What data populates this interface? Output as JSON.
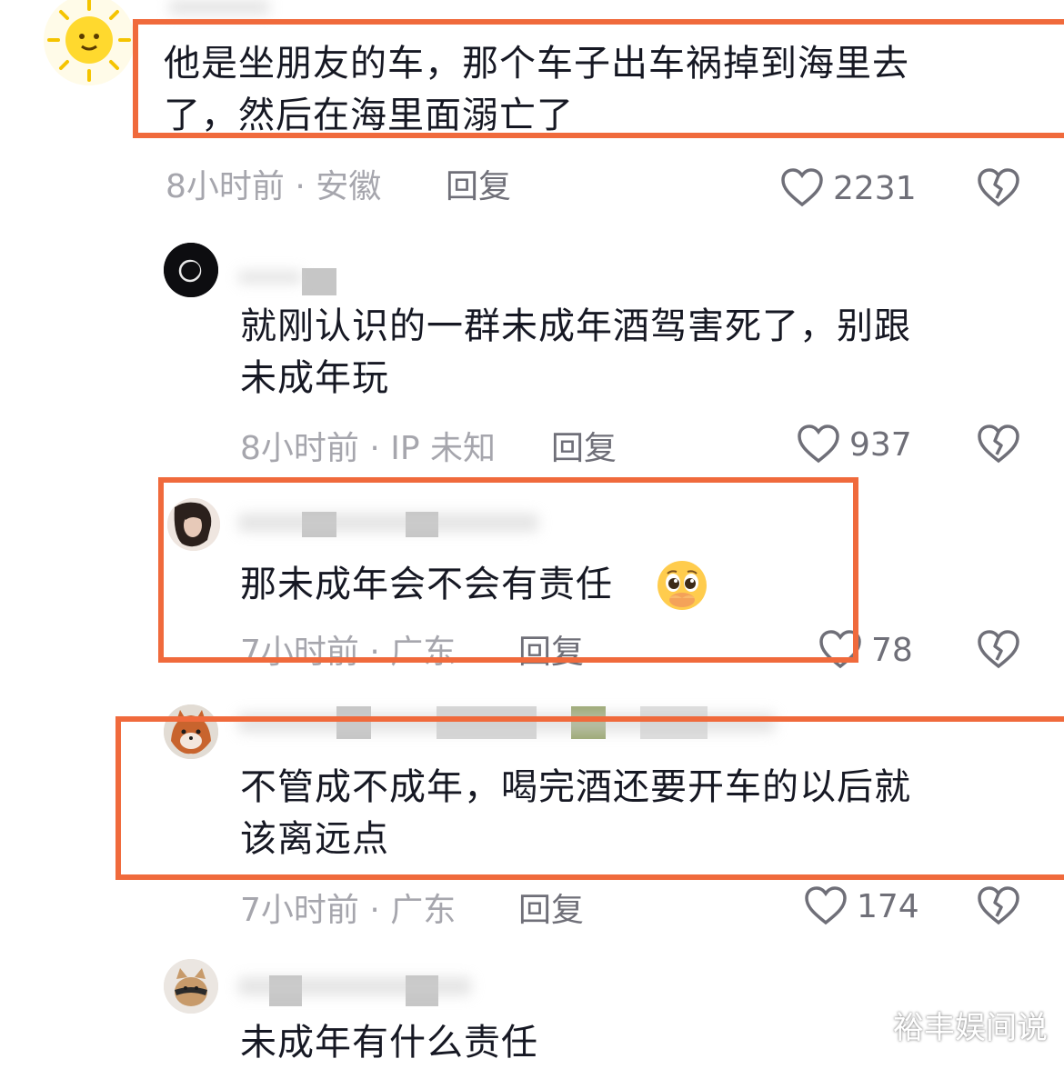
{
  "comments": [
    {
      "text_lines": [
        "他是坐朋友的车，那个车子出车祸掉到海里去",
        "了，然后在海里面溺亡了"
      ],
      "time": "8小时前 · 安徽",
      "reply_label": "回复",
      "likes": "2231"
    },
    {
      "text_lines": [
        "就刚认识的一群未成年酒驾害死了，别跟",
        "未成年玩"
      ],
      "time": "8小时前 · IP 未知",
      "reply_label": "回复",
      "likes": "937"
    },
    {
      "text_lines": [
        "那未成年会不会有责任"
      ],
      "time": "7小时前 · 广东",
      "reply_label": "回复",
      "likes": "78"
    },
    {
      "text_lines": [
        "不管成不成年，喝完酒还要开车的以后就",
        "该离远点"
      ],
      "time": "7小时前 · 广东",
      "reply_label": "回复",
      "likes": "174"
    },
    {
      "text_lines": [
        "未成年有什么责任"
      ]
    }
  ],
  "icons": {
    "like": "heart-outline-icon",
    "dislike": "broken-heart-icon",
    "emoji": "pleading-face-emoji"
  },
  "colors": {
    "highlight": "#f06a3c",
    "text": "#161823",
    "meta": "#a6a6ad"
  },
  "watermark": "裕丰娱间说"
}
